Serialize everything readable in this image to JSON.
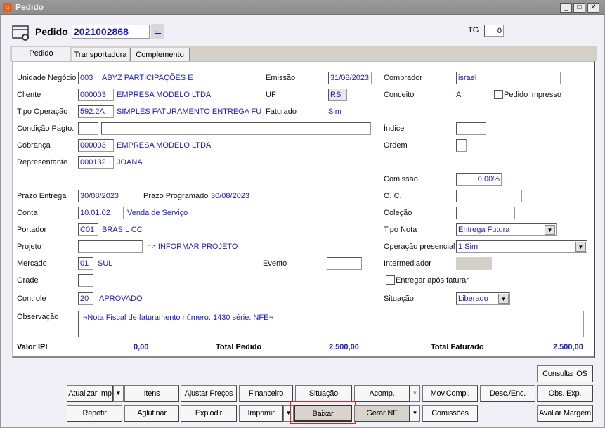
{
  "window": {
    "title": "Pedido",
    "minimize": "_",
    "maximize": "□",
    "close": "✕"
  },
  "header": {
    "label": "Pedido",
    "number": "2021002868",
    "lookup": "...",
    "tg_label": "TG",
    "tg_value": "0"
  },
  "tabs": [
    {
      "label": "Pedido",
      "selected": true
    },
    {
      "label": "Transportadora"
    },
    {
      "label": "Complemento"
    }
  ],
  "form": {
    "unidade": {
      "label": "Unidade Negócio",
      "code": "003",
      "desc": "ABYZ PARTICIPAÇÕES E"
    },
    "cliente": {
      "label": "Cliente",
      "code": "000003",
      "desc": "EMPRESA MODELO LTDA"
    },
    "tipo_op": {
      "label": "Tipo Operação",
      "code": "592.2A",
      "desc": "SIMPLES FATURAMENTO  ENTREGA FUTUR"
    },
    "cond": {
      "label": "Condição Pagto.",
      "code": "",
      "desc": ""
    },
    "cobranca": {
      "label": "Cobrança",
      "code": "000003",
      "desc": "EMPRESA MODELO LTDA"
    },
    "representante": {
      "label": "Representante",
      "code": "000132",
      "desc": "JOANA"
    },
    "emissao": {
      "label": "Emissão",
      "value": "31/08/2023"
    },
    "uf": {
      "label": "UF",
      "value": "RS"
    },
    "faturado": {
      "label": "Faturado",
      "value": "Sim"
    },
    "comprador": {
      "label": "Comprador",
      "value": "israel"
    },
    "conceito": {
      "label": "Conceito",
      "value": "A"
    },
    "pedido_impresso": {
      "label": "Pedido impresso",
      "checked": false
    },
    "indice": {
      "label": "Índice",
      "value": ""
    },
    "ordem": {
      "label": "Ordem",
      "value": ""
    },
    "comissao": {
      "label": "Comissão",
      "value": "0,00%"
    },
    "prazo_entrega": {
      "label": "Prazo Entrega",
      "value": "30/08/2023"
    },
    "prazo_prog": {
      "label": "Prazo Programado",
      "value": "30/08/2023"
    },
    "oc": {
      "label": "O. C.",
      "value": ""
    },
    "conta": {
      "label": "Conta",
      "code": "10.01.02",
      "desc": "Venda de Serviço"
    },
    "colecao": {
      "label": "Coleção",
      "value": ""
    },
    "portador": {
      "label": "Portador",
      "code": "C01",
      "desc": "BRASIL CC"
    },
    "tipo_nota": {
      "label": "Tipo Nota",
      "value": "Entrega Futura"
    },
    "projeto": {
      "label": "Projeto",
      "code": "",
      "desc": "=> INFORMAR PROJETO"
    },
    "op_presencial": {
      "label": "Operação presencial",
      "value": "1 Sim"
    },
    "mercado": {
      "label": "Mercado",
      "code": "01",
      "desc": "SUL"
    },
    "evento": {
      "label": "Evento",
      "value": ""
    },
    "intermediador": {
      "label": "Intermediador",
      "value": ""
    },
    "grade": {
      "label": "Grade",
      "value": ""
    },
    "entregar": {
      "label": "Entregar após faturar",
      "checked": false
    },
    "controle": {
      "label": "Controle",
      "code": "20",
      "desc": "APROVADO"
    },
    "situacao": {
      "label": "Situação",
      "value": "Liberado"
    },
    "observacao": {
      "label": "Observação",
      "value": "¬Nota Fiscal de faturamento número: 1430 série: NFE¬"
    }
  },
  "totals": {
    "ipi_label": "Valor IPI",
    "ipi": "0,00",
    "pedido_label": "Total Pedido",
    "pedido": "2.500,00",
    "faturado_label": "Total Faturado",
    "faturado": "2.500,00"
  },
  "buttons": {
    "consultar_os": "Consultar OS",
    "atualizar_imp": "Atualizar Imp",
    "itens": "Itens",
    "ajustar_precos": "Ajustar Preços",
    "financeiro": "Financeiro",
    "situacao": "Situação",
    "acomp": "Acomp.",
    "mov_compl": "Mov.Compl.",
    "desc_enc": "Desc./Enc.",
    "obs_exp": "Obs. Exp.",
    "repetir": "Repetir",
    "aglutinar": "Aglutinar",
    "explodir": "Explodir",
    "imprimir": "Imprimir",
    "baixar": "Baixar",
    "gerar_nf": "Gerar NF",
    "comissoes": "Comissões",
    "avaliar_margem": "Avaliar Margem"
  },
  "colors": {
    "highlight": "#e02020",
    "value_text": "#1a1acc"
  }
}
